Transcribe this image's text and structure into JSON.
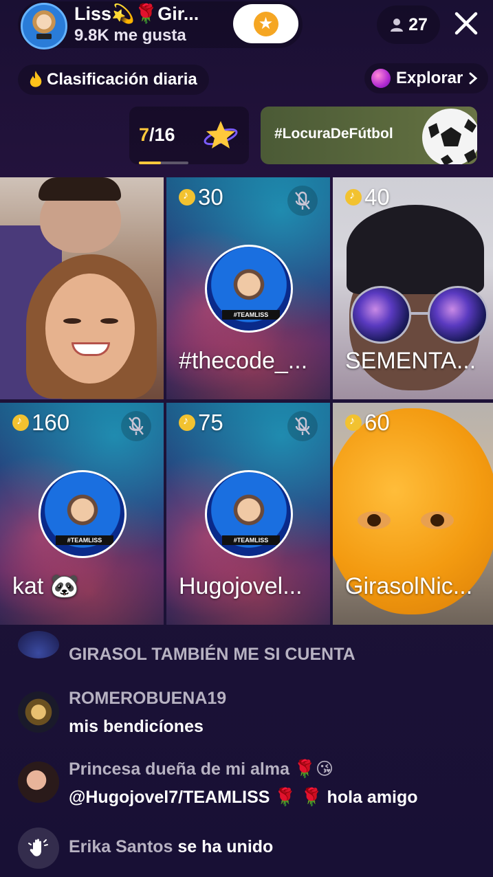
{
  "host": {
    "name": "Liss💫🌹Gir...",
    "likes": "9.8K me gusta"
  },
  "viewers": {
    "count": "27"
  },
  "ranking": {
    "label": "Clasificación diaria"
  },
  "explore": {
    "label": "Explorar"
  },
  "round": {
    "current": "7",
    "total": "/16",
    "progress_fraction": 0.4375
  },
  "hashtag": {
    "label": "#LocuraDeFútbol"
  },
  "guests": [
    {
      "coins": "",
      "name": ""
    },
    {
      "coins": "30",
      "name": "#thecode_...",
      "muted": true
    },
    {
      "coins": "40",
      "name": "SEMENTA...",
      "muted": false
    },
    {
      "coins": "160",
      "name": "kat 🐼",
      "muted": true
    },
    {
      "coins": "75",
      "name": "Hugojovel...",
      "muted": true
    },
    {
      "coins": "60",
      "name": "GirasolNic...",
      "muted": false
    }
  ],
  "avatar_banner": "#TEAMLISS",
  "chat": [
    {
      "user": "GIRASOL TAMBIÉN ME SI CUENTA",
      "msg": ""
    },
    {
      "user": "ROMEROBUENA19",
      "msg": "mis bendicíones"
    },
    {
      "user": "Princesa dueña de mi alma 🌹😘",
      "msg": "@Hugojovel7/TEAMLISS 🌹 🌹 hola amigo"
    },
    {
      "user": "Erika Santos",
      "msg": " se ha unido"
    }
  ],
  "colors": {
    "accent_gold": "#ffc93c",
    "coin": "#f2c230",
    "background": "#1c1236"
  },
  "icons": [
    "person-icon",
    "close-icon",
    "star-icon",
    "flame-icon",
    "chevron-right-icon",
    "mic-muted-icon",
    "coin-icon",
    "wave-hand-icon",
    "soccer-ball-icon"
  ]
}
